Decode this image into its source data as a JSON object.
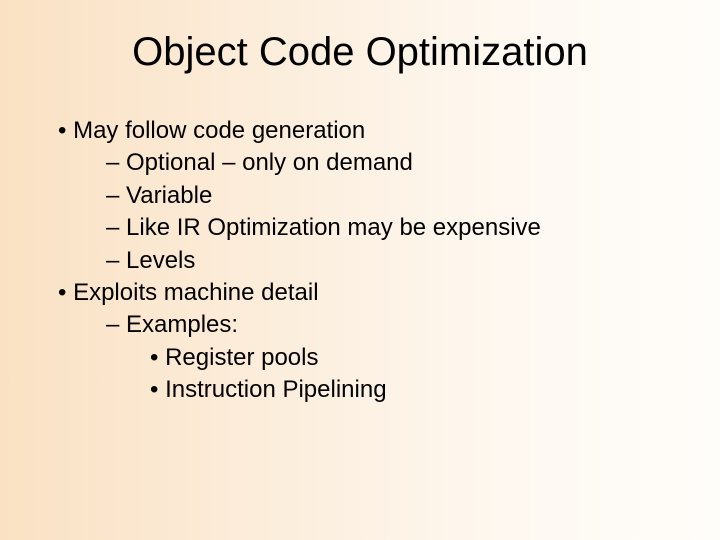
{
  "title": "Object Code Optimization",
  "bullets": {
    "b1": "May follow code generation",
    "b1a": "Optional – only on demand",
    "b1b": "Variable",
    "b1c": "Like IR Optimization may be expensive",
    "b1d": "Levels",
    "b2": "Exploits machine detail",
    "b2a": "Examples:",
    "b2a1": "Register pools",
    "b2a2": "Instruction Pipelining"
  }
}
